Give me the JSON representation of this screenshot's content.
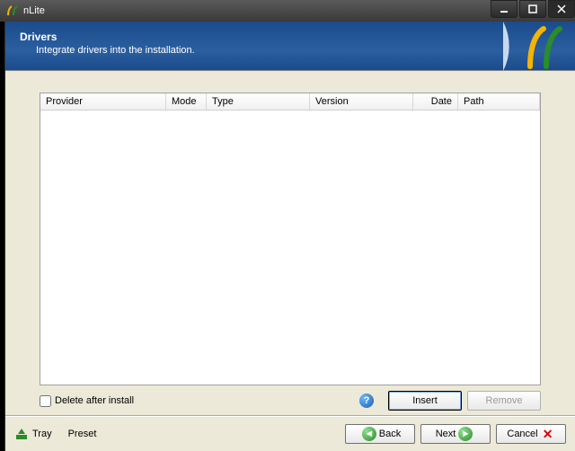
{
  "window": {
    "title": "nLite"
  },
  "header": {
    "title": "Drivers",
    "subtitle": "Integrate drivers into the installation."
  },
  "columns": {
    "provider": "Provider",
    "mode": "Mode",
    "type": "Type",
    "version": "Version",
    "date": "Date",
    "path": "Path"
  },
  "underlist": {
    "delete_after_install": "Delete after install",
    "insert": "Insert",
    "remove": "Remove"
  },
  "footer": {
    "tray": "Tray",
    "preset": "Preset",
    "back": "Back",
    "next": "Next",
    "cancel": "Cancel"
  }
}
